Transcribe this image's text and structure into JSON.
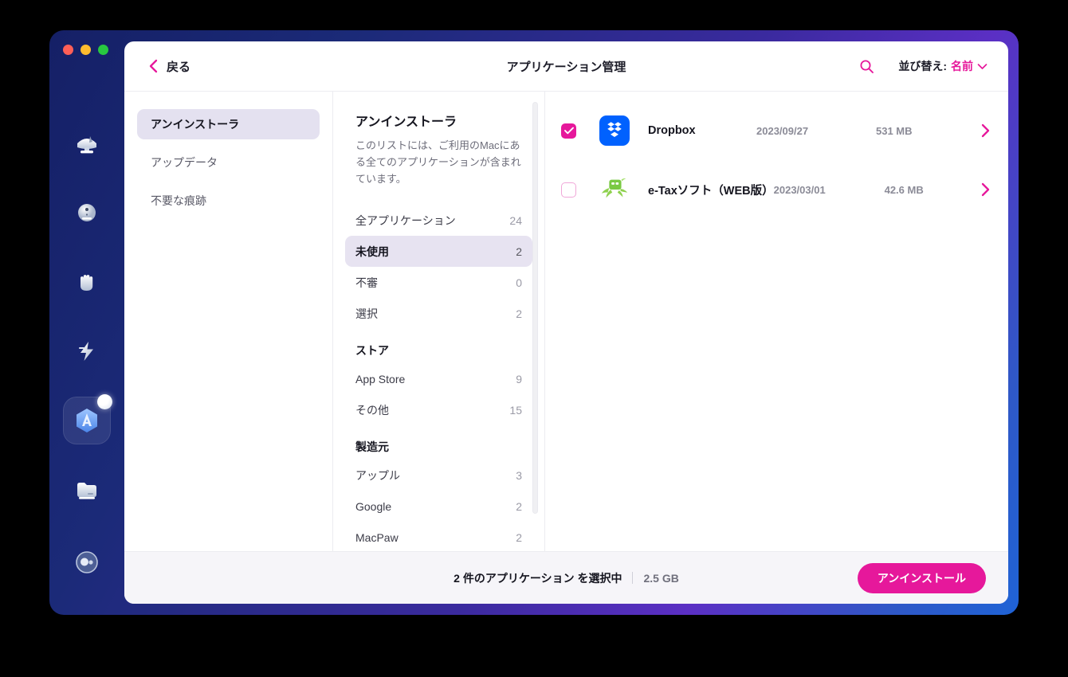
{
  "window": {
    "traffic_lights": [
      "close",
      "minimize",
      "zoom"
    ],
    "title": "アプリケーション管理"
  },
  "header": {
    "back_label": "戻る",
    "back_icon": "chevron-left-icon",
    "search_icon": "search-icon",
    "sort_label": "並び替え:",
    "sort_value": "名前",
    "sort_chevron_icon": "chevron-down-icon"
  },
  "rail": {
    "items": [
      {
        "icon": "scanner-brush-icon",
        "active": false,
        "badge": false
      },
      {
        "icon": "protection-droplet-icon",
        "active": false,
        "badge": false
      },
      {
        "icon": "hand-privacy-icon",
        "active": false,
        "badge": false
      },
      {
        "icon": "lightning-speed-icon",
        "active": false,
        "badge": false
      },
      {
        "icon": "applications-hex-icon",
        "active": true,
        "badge": true
      },
      {
        "icon": "files-folder-icon",
        "active": false,
        "badge": false
      }
    ],
    "bottom": {
      "icon": "assistant-orb-icon"
    }
  },
  "sidebar": {
    "items": [
      {
        "label": "アンインストーラ",
        "active": true
      },
      {
        "label": "アップデータ",
        "active": false
      },
      {
        "label": "不要な痕跡",
        "active": false
      }
    ]
  },
  "category_panel": {
    "title": "アンインストーラ",
    "description": "このリストには、ご利用のMacにある全てのアプリケーションが含まれています。",
    "rows": [
      {
        "label": "全アプリケーション",
        "count": "24",
        "active": false
      },
      {
        "label": "未使用",
        "count": "2",
        "active": true
      },
      {
        "label": "不審",
        "count": "0",
        "active": false
      },
      {
        "label": "選択",
        "count": "2",
        "active": false
      }
    ],
    "store_heading": "ストア",
    "store_rows": [
      {
        "label": "App Store",
        "count": "9",
        "active": false
      },
      {
        "label": "その他",
        "count": "15",
        "active": false
      }
    ],
    "vendor_heading": "製造元",
    "vendor_rows": [
      {
        "label": "アップル",
        "count": "3",
        "active": false
      },
      {
        "label": "Google",
        "count": "2",
        "active": false
      },
      {
        "label": "MacPaw",
        "count": "2",
        "active": false
      }
    ],
    "scrollbar": "vertical-scrollbar"
  },
  "app_list": {
    "rows": [
      {
        "checked": true,
        "icon": "dropbox-app-icon",
        "name": "Dropbox",
        "date": "2023/09/27",
        "size": "531 MB",
        "chevron": "chevron-right-icon"
      },
      {
        "checked": false,
        "icon": "etax-app-icon",
        "name": "e-Taxソフト（WEB版）",
        "date": "2023/03/01",
        "size": "42.6 MB",
        "chevron": "chevron-right-icon"
      }
    ]
  },
  "footer": {
    "selection_text": "2 件のアプリケーション を選択中",
    "selection_size": "2.5 GB",
    "uninstall_label": "アンインストール"
  },
  "colors": {
    "accent_magenta": "#e6189b",
    "selection_lavender": "#e4e1f0",
    "rail_navy": "#152066",
    "frame_purple": "#5b2fc4",
    "frame_blue": "#1f63d6",
    "dropbox_blue": "#0061fe",
    "etax_green": "#7ac943"
  }
}
